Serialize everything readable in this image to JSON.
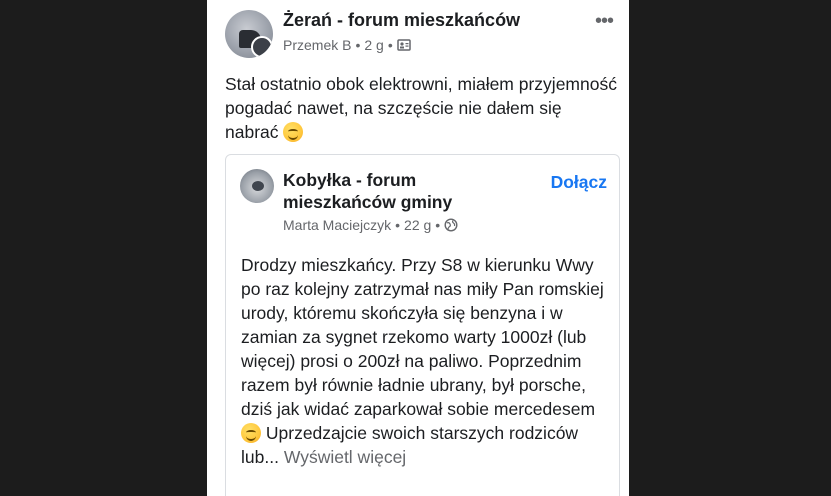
{
  "post": {
    "group_name": "Żerań - forum mieszkańców",
    "author": "Przemek B",
    "time": "2 g",
    "separator": "•",
    "audience_icon": "group-audience-icon",
    "more_icon": "more-options-icon",
    "more_label": "•••",
    "text": "Stał ostatnio obok elektrowni, miałem przyjemność pogadać nawet, na szczęście nie dałem się nabrać",
    "text_emoji": "smirking-face-emoji"
  },
  "shared_post": {
    "group_name": "Kobyłka - forum mieszkańców gminy",
    "join_label": "Dołącz",
    "author": "Marta Maciejczyk",
    "time": "22 g",
    "separator": "•",
    "audience_icon": "globe-icon",
    "text": "Drodzy mieszkańcy. Przy S8 w kierunku Wwy po raz kolejny zatrzymał nas miły Pan romskiej urody, któremu skończyła się benzyna i w zamian za sygnet rzekomo warty 1000zł (lub więcej) prosi o 200zł na paliwo. Poprzednim razem był równie ładnie ubrany, był porsche, dziś jak widać zaparkował sobie mercedesem",
    "text_emoji": "grinning-face-emoji",
    "text_after": "Uprzedzajcie swoich starszych rodziców lub...",
    "see_more_label": "Wyświetl więcej"
  },
  "colors": {
    "background": "#1c1c1c",
    "card": "#ffffff",
    "link": "#1877f2",
    "meta": "#65676b",
    "text": "#1c1e21"
  }
}
